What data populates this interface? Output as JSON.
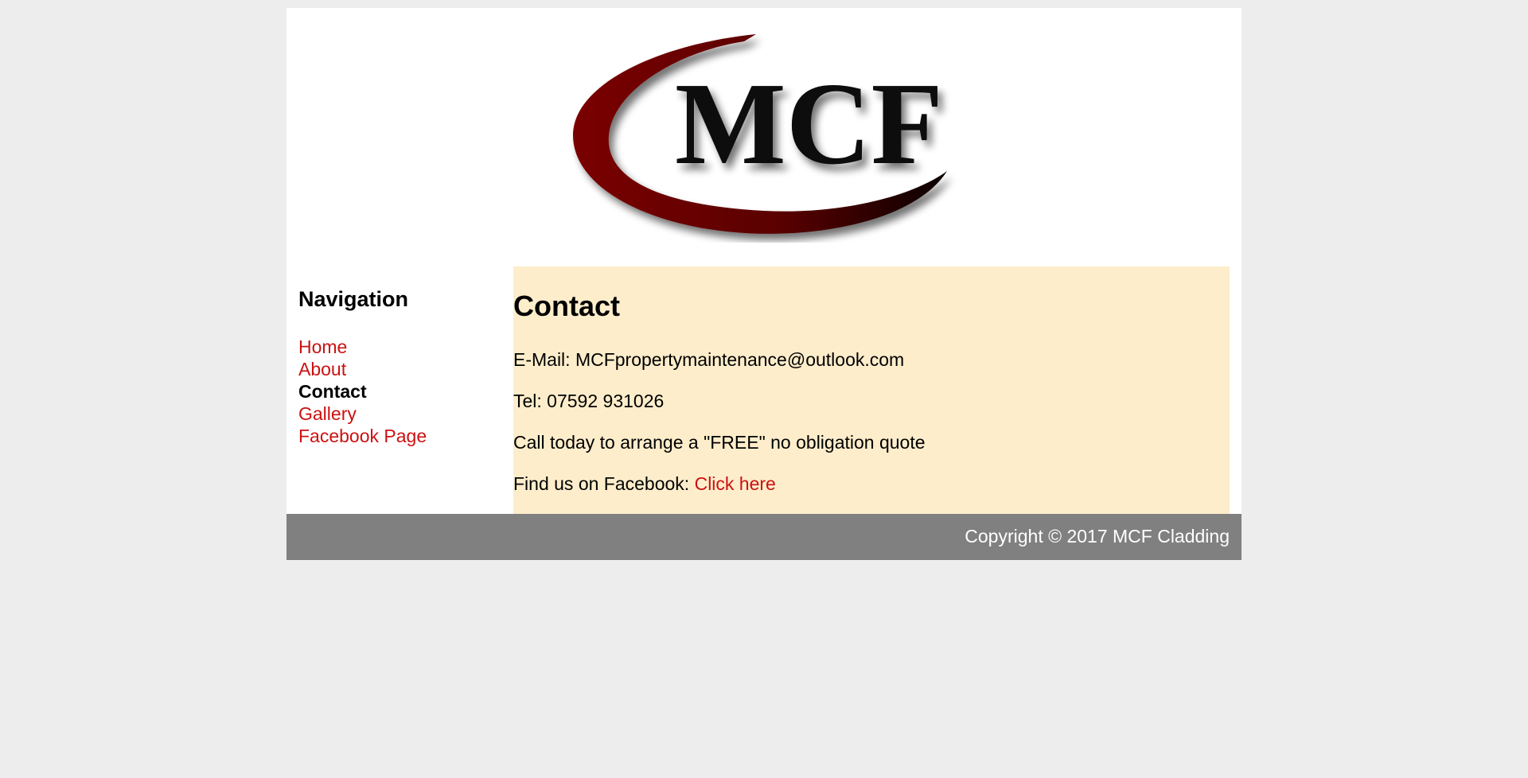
{
  "header": {
    "logo_text": "MCF"
  },
  "nav": {
    "heading": "Navigation",
    "items": [
      {
        "label": "Home"
      },
      {
        "label": "About"
      },
      {
        "label": "Contact"
      },
      {
        "label": "Gallery"
      },
      {
        "label": "Facebook Page"
      }
    ],
    "current": "Contact"
  },
  "main": {
    "title": "Contact",
    "email_line": "E-Mail: MCFpropertymaintenance@outlook.com",
    "tel_line": "Tel: 07592 931026",
    "call_line": "Call today to arrange a \"FREE\" no obligation quote",
    "facebook_prefix": "Find us on Facebook:",
    "facebook_link": "Click here"
  },
  "footer": {
    "copyright": "Copyright © 2017 MCF Cladding"
  },
  "colors": {
    "page_bg": "#ededed",
    "content_bg": "#fdedcb",
    "link": "#cc1111",
    "footer_bg": "#808080",
    "logo_swoosh": "#7a0000"
  }
}
